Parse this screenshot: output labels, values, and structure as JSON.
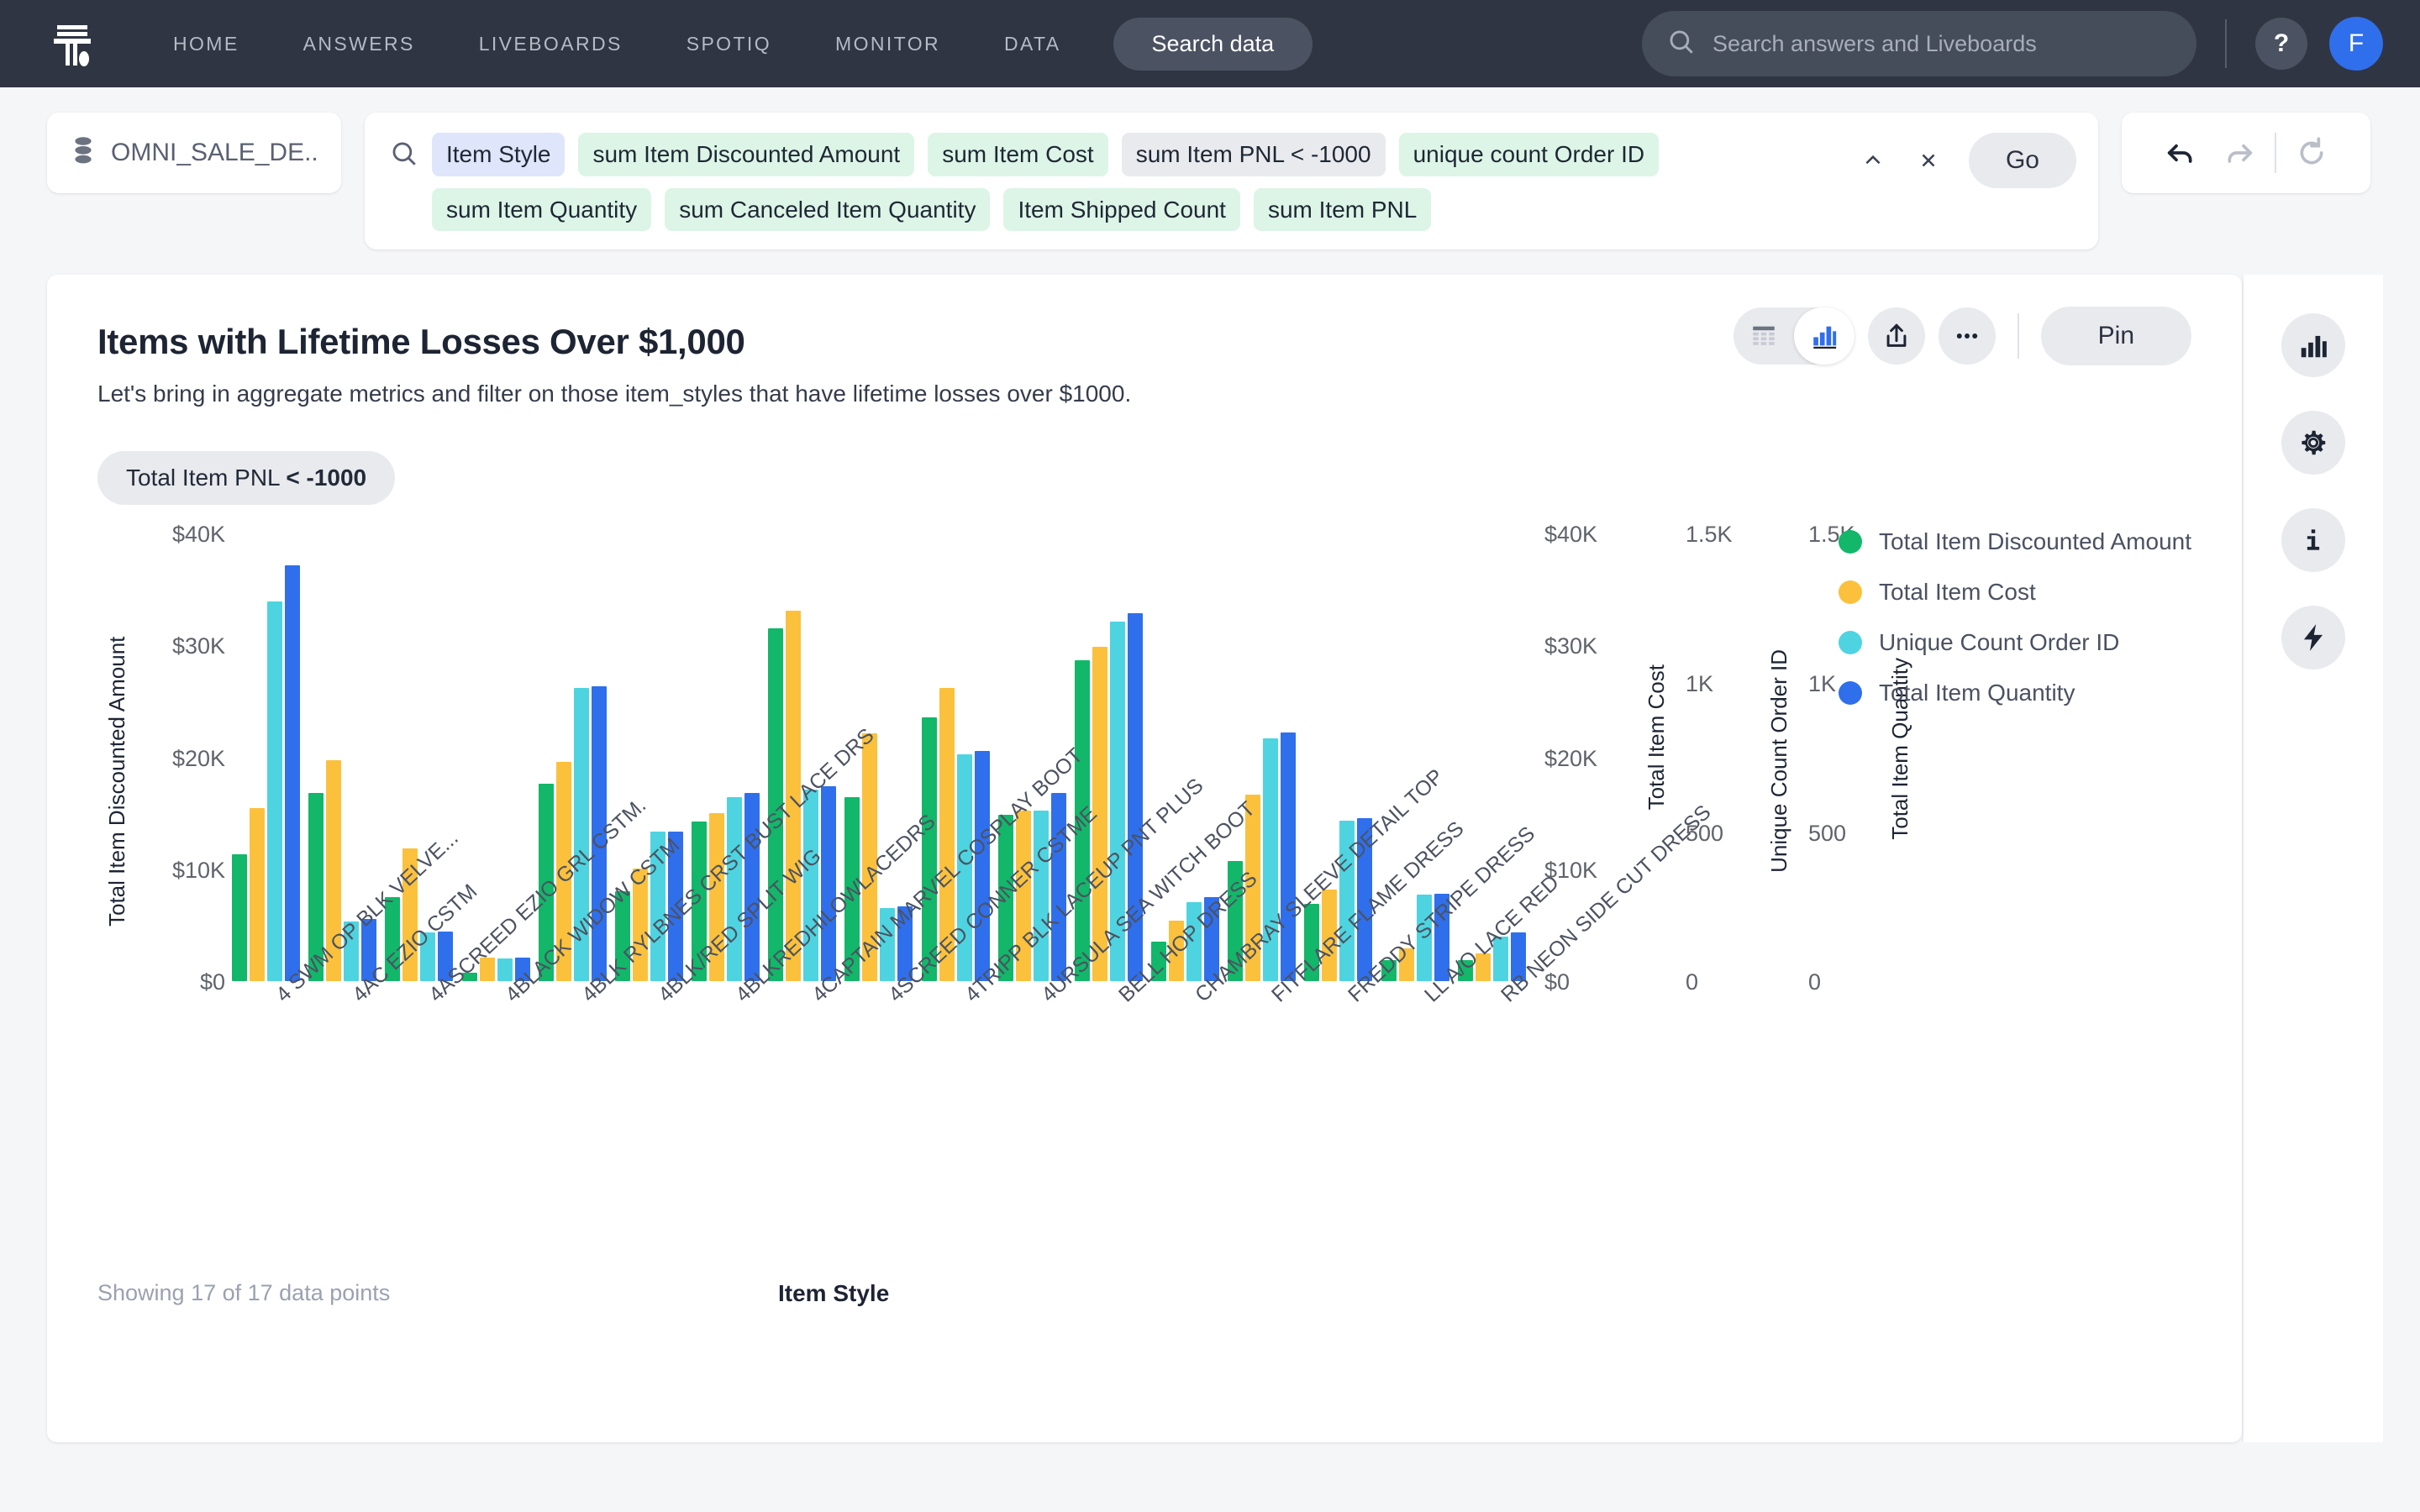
{
  "topnav": {
    "logo_name": "thoughtspot-logo",
    "links": [
      "HOME",
      "ANSWERS",
      "LIVEBOARDS",
      "SPOTIQ",
      "MONITOR",
      "DATA"
    ],
    "search_data_label": "Search data",
    "global_search_placeholder": "Search answers and Liveboards",
    "help_label": "?",
    "avatar_initial": "F",
    "bg_color": "#2f3542",
    "accent_color": "#2f6fec"
  },
  "querybar": {
    "source_label": "OMNI_SALE_DE...",
    "search_icon": "search-icon",
    "tokens": [
      {
        "text": "Item Style",
        "kind": "attr"
      },
      {
        "text": "sum Item Discounted Amount",
        "kind": "meas"
      },
      {
        "text": "sum Item Cost",
        "kind": "meas"
      },
      {
        "text": "sum Item PNL < -1000",
        "kind": "filt"
      },
      {
        "text": "unique count Order ID",
        "kind": "meas"
      },
      {
        "text": "sum Item Quantity",
        "kind": "meas"
      },
      {
        "text": "sum Canceled Item Quantity",
        "kind": "meas"
      },
      {
        "text": "Item Shipped Count",
        "kind": "meas"
      },
      {
        "text": "sum Item PNL",
        "kind": "meas"
      }
    ],
    "collapse_label": "⌃",
    "clear_label": "✕",
    "go_label": "Go",
    "undo_icon": "undo-icon",
    "redo_icon": "redo-icon",
    "reset_icon": "reset-icon"
  },
  "card": {
    "title": "Items with Lifetime Losses Over $1,000",
    "subtitle": "Let's bring in aggregate metrics and filter on those item_styles that have lifetime losses over $1000.",
    "filter_pill_prefix": "Total Item PNL ",
    "filter_pill_value": "< -1000",
    "pin_label": "Pin",
    "table_icon": "table-view-icon",
    "chart_icon": "chart-view-icon",
    "share_icon": "share-icon",
    "more_icon": "more-options-icon",
    "footer_count": "Showing 17 of 17 data points"
  },
  "right_rail": {
    "items": [
      {
        "icon": "chart-config-icon"
      },
      {
        "icon": "gear-icon"
      },
      {
        "icon": "info-icon"
      },
      {
        "icon": "lightning-icon"
      }
    ]
  },
  "chart_data": {
    "type": "bar",
    "title": "Items with Lifetime Losses Over $1,000",
    "xlabel": "Item Style",
    "grid": false,
    "legend_position": "right",
    "categories": [
      "4 SWM OP BLK VELVE...",
      "4AC EZIO CSTM",
      "4ASCREED EZIO GRL CSTM.",
      "4BLACK WIDOW CSTM",
      "4BLK RYLBNES CRST BUST LACE DRS",
      "4BLK/RED SPLIT WIG",
      "4BLKREDHILOWLACEDRS",
      "4CAPTAIN MARVEL COSPLAY BOOT",
      "4SCREED CONNER CSTME",
      "4TRIPP BLK LACEUP PNT PLUS",
      "4URSULA SEA WITCH BOOT",
      "BELL HOP DRESS",
      "CHAMBRAY SLEEVE DETAIL TOP",
      "FITFLARE FLAME DRESS",
      "FREDDY STRIPE DRESS",
      "LL A/O LACE RED",
      "RB NEON SIDE CUT DRESS"
    ],
    "axes": [
      {
        "name": "Total Item Discounted Amount",
        "side": "left",
        "ticks": [
          "$0",
          "$10K",
          "$20K",
          "$30K",
          "$40K"
        ],
        "range": [
          0,
          40000
        ]
      },
      {
        "name": "Total Item Cost",
        "side": "right",
        "ticks": [
          "$0",
          "$10K",
          "$20K",
          "$30K",
          "$40K"
        ],
        "range": [
          0,
          40000
        ]
      },
      {
        "name": "Unique Count Order ID",
        "side": "right",
        "ticks": [
          "0",
          "500",
          "1K",
          "1.5K"
        ],
        "range": [
          0,
          1500
        ]
      },
      {
        "name": "Total Item Quantity",
        "side": "right",
        "ticks": [
          "0",
          "500",
          "1K",
          "1.5K"
        ],
        "range": [
          0,
          1500
        ]
      }
    ],
    "series": [
      {
        "name": "Total Item Discounted Amount",
        "color": "#12b76a",
        "axis": "Total Item Discounted Amount",
        "values": [
          11300,
          16800,
          7500,
          800,
          17600,
          8000,
          14200,
          31400,
          16400,
          23500,
          14800,
          28600,
          3500,
          10700,
          6900,
          1900,
          1900
        ]
      },
      {
        "name": "Total Item Cost",
        "color": "#fbc13c",
        "axis": "Total Item Cost",
        "values": [
          15400,
          19700,
          11800,
          2100,
          19500,
          10000,
          15000,
          33000,
          22100,
          26100,
          15200,
          29800,
          5400,
          16600,
          8200,
          2900,
          2500
        ]
      },
      {
        "name": "Unique Count Order ID",
        "color": "#4dd4e0",
        "axis": "Unique Count Order ID",
        "values": [
          1268,
          200,
          162,
          75,
          980,
          500,
          615,
          640,
          245,
          758,
          570,
          1200,
          265,
          810,
          535,
          290,
          150
        ]
      },
      {
        "name": "Total Item Quantity",
        "color": "#2f6fec",
        "axis": "Total Item Quantity",
        "values": [
          1388,
          207,
          165,
          80,
          985,
          500,
          630,
          650,
          250,
          770,
          628,
          1230,
          282,
          830,
          545,
          292,
          163
        ]
      }
    ]
  }
}
